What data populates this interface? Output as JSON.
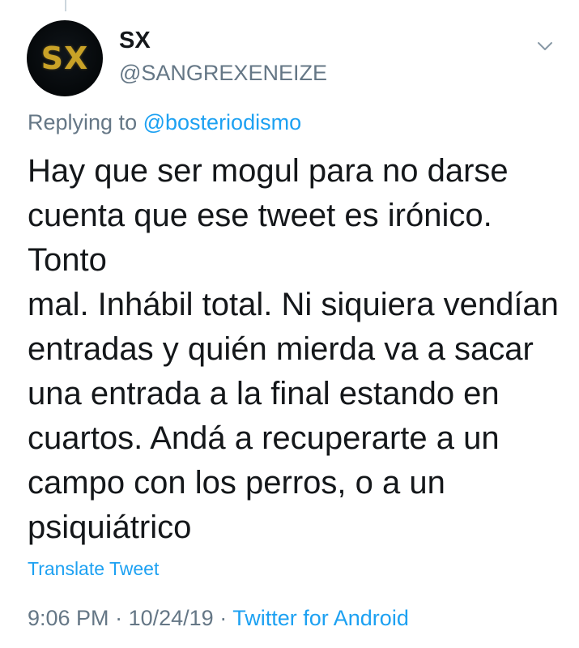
{
  "avatar": {
    "text": "SX"
  },
  "user": {
    "display_name": "SX",
    "handle": "@SANGREXENEIZE"
  },
  "reply": {
    "prefix": "Replying to",
    "mention": "@bosteriodismo"
  },
  "tweet": {
    "text": "Hay que ser mogul para no darse\ncuenta que ese tweet es irónico. Tonto\nmal. Inhábil total. Ni siquiera vendían\nentradas y quién mierda va a sacar\nuna entrada a la final estando en\ncuartos. Andá a recuperarte a un\ncampo con los perros, o a un\npsiquiátrico"
  },
  "actions": {
    "translate_label": "Translate Tweet"
  },
  "meta": {
    "time": "9:06 PM",
    "separator": "·",
    "date": "10/24/19",
    "source": "Twitter for Android"
  },
  "icons": {
    "menu": "chevron-down-icon"
  },
  "colors": {
    "link": "#1da1f2",
    "secondary_text": "#657786",
    "primary_text": "#14171a",
    "avatar_bg": "#05080a",
    "avatar_text": "#c9a227"
  }
}
